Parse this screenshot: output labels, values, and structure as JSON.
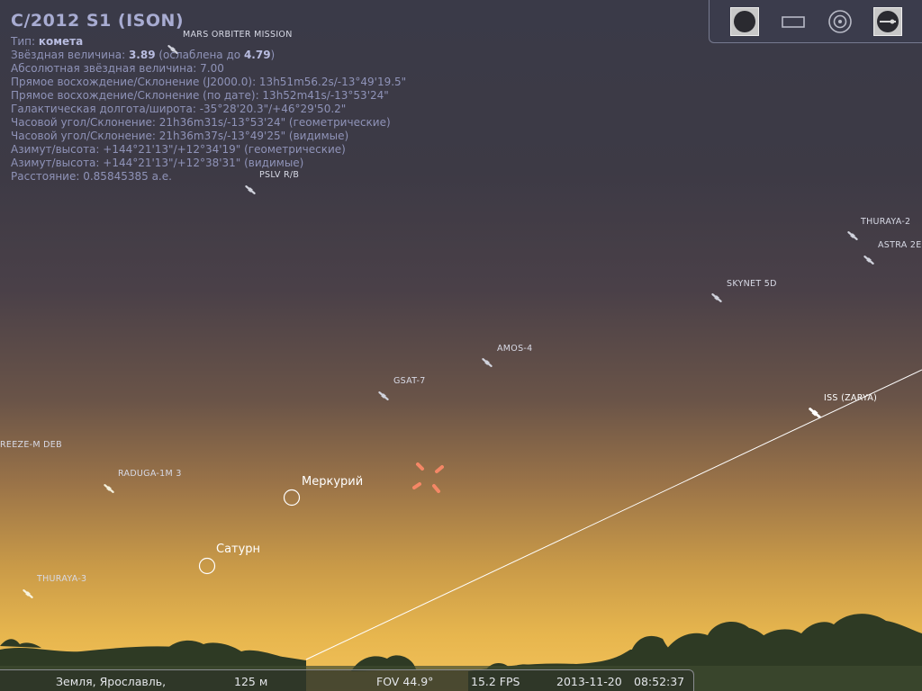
{
  "object_info": {
    "title": "C/2012 S1 (ISON)",
    "type_label": "Тип: ",
    "type_value": "комета",
    "magnitude_label": "Звёздная величина: ",
    "magnitude_value": "3.89",
    "magnitude_extinct_prefix": " (ослаблена до ",
    "magnitude_extinct_value": "4.79",
    "magnitude_extinct_suffix": ")",
    "abs_magnitude": "Абсолютная звёздная величина: 7.00",
    "ra_dec_j2000": "Прямое восхождение/Склонение (J2000.0): 13h51m56.2s/-13°49'19.5\"",
    "ra_dec_date": "Прямое восхождение/Склонение (по дате): 13h52m41s/-13°53'24\"",
    "galactic": "Галактическая долгота/широта: -35°28'20.3\"/+46°29'50.2\"",
    "hour_angle_geo": "Часовой угол/Склонение: 21h36m31s/-13°53'24\" (геометрические)",
    "hour_angle_app": "Часовой угол/Склонение: 21h36m37s/-13°49'25\" (видимые)",
    "az_alt_geo": "Азимут/высота: +144°21'13\"/+12°34'19\" (геометрические)",
    "az_alt_app": "Азимут/высота: +144°21'13\"/+12°38'31\" (видимые)",
    "distance": "Расстояние: 0.85845385 а.е."
  },
  "satellites": {
    "mars_orbiter": "MARS ORBITER MISSION",
    "pslv": "PSLV R/B",
    "thuraya2": "THURAYA-2",
    "astra2e": "ASTRA 2E",
    "skynet5d": "SKYNET 5D",
    "amos4": "AMOS-4",
    "gsat7": "GSAT-7",
    "iss": "ISS (ZARYA)",
    "breeze": "REEZE-M DEB",
    "raduga": "RADUGA-1M 3",
    "thuraya3": "THURAYA-3"
  },
  "planets": {
    "mercury": "Меркурий",
    "saturn": "Сатурн"
  },
  "toolbar": {
    "buttons": [
      "circle-mask-icon",
      "rectangle-mask-icon",
      "target-icon",
      "sensor-icon"
    ]
  },
  "status": {
    "location": "Земля, Ярославль,",
    "altitude": "125 м",
    "fov": "FOV 44.9°",
    "fps": "15.2 FPS",
    "date": "2013-11-20",
    "time": "08:52:37"
  },
  "colors": {
    "info_text": "#8f93b8",
    "marker": "#ff8a6a",
    "sat_label": "#d8dae6"
  }
}
